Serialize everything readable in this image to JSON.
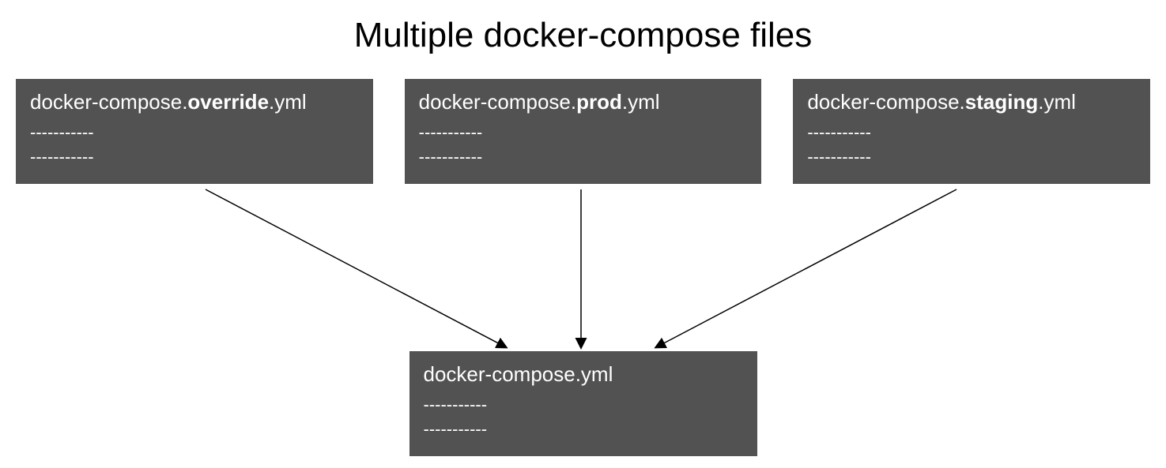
{
  "title": "Multiple docker-compose files",
  "topFiles": [
    {
      "prefix": "docker-compose.",
      "bold": "override",
      "suffix": ".yml",
      "dashes1": "-----------",
      "dashes2": "-----------"
    },
    {
      "prefix": "docker-compose.",
      "bold": "prod",
      "suffix": ".yml",
      "dashes1": "-----------",
      "dashes2": "-----------"
    },
    {
      "prefix": "docker-compose.",
      "bold": "staging",
      "suffix": ".yml",
      "dashes1": "-----------",
      "dashes2": "-----------"
    }
  ],
  "bottomFile": {
    "name": "docker-compose.yml",
    "dashes1": "-----------",
    "dashes2": "-----------"
  }
}
